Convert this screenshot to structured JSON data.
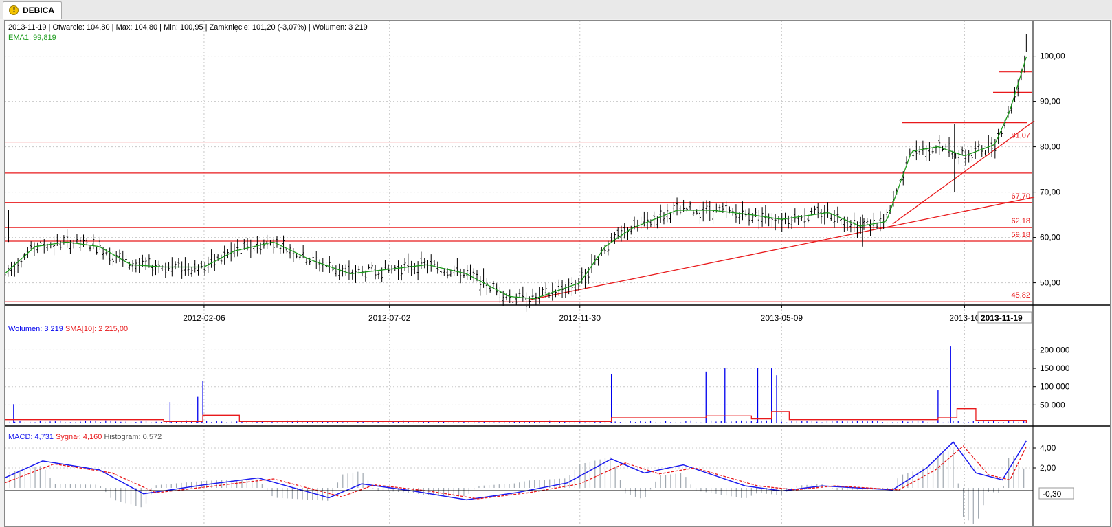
{
  "tab": {
    "label": "DEBICA",
    "icon": "warning-icon"
  },
  "info": {
    "date": "2013-11-19",
    "open": "Otwarcie: 104,80",
    "max": "Max: 104,80",
    "min": "Min: 100,95",
    "close": "Zamknięcie: 101,20 (-3,07%)",
    "volume": "Wolumen: 3 219",
    "ema": "EMA1: 99,819"
  },
  "volume_legend": {
    "volume": "Wolumen: 3 219",
    "sma": "SMA[10]: 2 215,00"
  },
  "macd_legend": {
    "macd": "MACD: 4,731",
    "signal": "Sygnał: 4,160",
    "histogram": "Histogram: 0,572"
  },
  "x_ticks": [
    "2012-02-06",
    "2012-07-02",
    "2012-11-30",
    "2013-05-09",
    "2013-10"
  ],
  "cursor_date": "2013-11-19",
  "price_ticks": [
    "100,00",
    "90,00",
    "80,00",
    "70,00",
    "60,00",
    "50,00"
  ],
  "volume_ticks": [
    "200 000",
    "150 000",
    "100 000",
    "50 000"
  ],
  "macd_ticks": [
    "4,00",
    "2,00"
  ],
  "macd_cursor_value": "-0,30",
  "levels": [
    "81,07",
    "67,70",
    "62,18",
    "59,18",
    "45,82"
  ],
  "colors": {
    "candles": "#000000",
    "ema": "#1a9a1a",
    "levels": "#e8191b",
    "volume": "#0000ee",
    "sma": "#e8191b",
    "macd": "#1a1aee",
    "signal": "#e8191b",
    "histogram": "#a0a8b0"
  },
  "chart_data": [
    {
      "type": "line",
      "title": "DEBICA",
      "series": [
        {
          "name": "EMA1",
          "x": [
            "2011-09-01",
            "2011-09-25",
            "2011-10-20",
            "2011-11-15",
            "2011-12-10",
            "2012-01-05",
            "2012-02-06",
            "2012-03-01",
            "2012-04-01",
            "2012-05-01",
            "2012-06-01",
            "2012-07-02",
            "2012-08-01",
            "2012-09-01",
            "2012-10-05",
            "2012-10-25",
            "2012-11-30",
            "2012-12-20",
            "2013-01-10",
            "2013-02-15",
            "2013-03-15",
            "2013-04-15",
            "2013-05-09",
            "2013-06-15",
            "2013-07-10",
            "2013-07-31",
            "2013-08-20",
            "2013-09-10",
            "2013-10-01",
            "2013-10-25",
            "2013-11-06",
            "2013-11-19"
          ],
          "values": [
            52,
            58,
            59,
            58,
            54,
            53.5,
            53.5,
            57,
            59,
            55,
            52,
            53,
            54,
            52,
            47,
            46.5,
            50,
            58,
            62,
            66,
            66,
            65,
            64,
            65.5,
            62.5,
            63.5,
            79,
            80,
            78,
            80.5,
            88,
            99.8
          ]
        }
      ],
      "levels": [
        81.07,
        67.7,
        62.18,
        59.18,
        45.82,
        74.2
      ],
      "ylim": [
        45.5,
        105
      ]
    },
    {
      "type": "bar",
      "series": [
        {
          "name": "Wolumen",
          "x": [
            "2011-09-08",
            "2012-01-10",
            "2012-02-01",
            "2012-02-05",
            "2012-12-25",
            "2013-03-10",
            "2013-03-25",
            "2013-04-20",
            "2013-05-01",
            "2013-05-05",
            "2013-09-10",
            "2013-09-20",
            "2013-11-19"
          ],
          "values": [
            52000,
            58000,
            72000,
            115000,
            135000,
            141000,
            150000,
            151000,
            150000,
            131000,
            90000,
            210000,
            3219
          ]
        },
        {
          "name": "SMA[10]",
          "x": [
            "2011-09-01",
            "2012-01-05",
            "2012-02-05",
            "2012-03-05",
            "2012-12-25",
            "2013-01-10",
            "2013-03-10",
            "2013-04-15",
            "2013-05-01",
            "2013-05-15",
            "2013-09-10",
            "2013-09-25",
            "2013-10-10",
            "2013-11-19"
          ],
          "values": [
            10000,
            5000,
            22000,
            5000,
            15000,
            15000,
            20000,
            12000,
            32000,
            10000,
            15000,
            40000,
            8000,
            2215
          ]
        }
      ],
      "ylim": [
        0,
        215000
      ]
    },
    {
      "type": "line",
      "series": [
        {
          "name": "MACD",
          "x": [
            "2011-09-01",
            "2011-10-01",
            "2011-11-15",
            "2011-12-20",
            "2012-02-06",
            "2012-03-20",
            "2012-05-15",
            "2012-06-10",
            "2012-07-20",
            "2012-09-01",
            "2012-10-10",
            "2012-11-20",
            "2012-12-25",
            "2013-01-20",
            "2013-02-20",
            "2013-04-10",
            "2013-05-09",
            "2013-06-10",
            "2013-08-05",
            "2013-09-01",
            "2013-09-22",
            "2013-10-10",
            "2013-10-31",
            "2013-11-19"
          ],
          "values": [
            1,
            2.7,
            1.8,
            -0.6,
            0.3,
            1,
            -1,
            0.4,
            -0.3,
            -1.2,
            -0.5,
            0.5,
            2.9,
            1.5,
            2.3,
            0.2,
            -0.3,
            0.2,
            -0.2,
            2,
            4.6,
            1.5,
            0.8,
            4.7
          ]
        },
        {
          "name": "Sygnał",
          "x": [
            "2011-09-01",
            "2011-10-10",
            "2011-11-25",
            "2011-12-30",
            "2012-02-15",
            "2012-04-01",
            "2012-05-25",
            "2012-06-20",
            "2012-08-01",
            "2012-09-10",
            "2012-10-20",
            "2012-11-30",
            "2013-01-05",
            "2013-02-01",
            "2013-03-01",
            "2013-04-20",
            "2013-05-20",
            "2013-06-20",
            "2013-08-10",
            "2013-09-08",
            "2013-09-30",
            "2013-10-20",
            "2013-11-06",
            "2013-11-19"
          ],
          "values": [
            0.5,
            2.4,
            1.5,
            -0.5,
            0.2,
            0.9,
            -0.9,
            0.3,
            -0.3,
            -1.1,
            -0.5,
            0.4,
            2.5,
            1.4,
            2,
            0.2,
            -0.2,
            0.2,
            -0.2,
            1.8,
            4.2,
            1.3,
            0.8,
            4.16
          ]
        },
        {
          "name": "Histogram",
          "x": [
            "2011-09-20",
            "2011-12-01",
            "2012-03-01",
            "2012-06-01",
            "2012-12-20",
            "2013-03-01",
            "2013-09-20",
            "2013-11-19"
          ],
          "values": [
            0.3,
            -0.3,
            0.2,
            -0.3,
            0.3,
            -0.4,
            0.9,
            0.572
          ]
        }
      ],
      "ylim": [
        -1.5,
        5.5
      ]
    }
  ]
}
